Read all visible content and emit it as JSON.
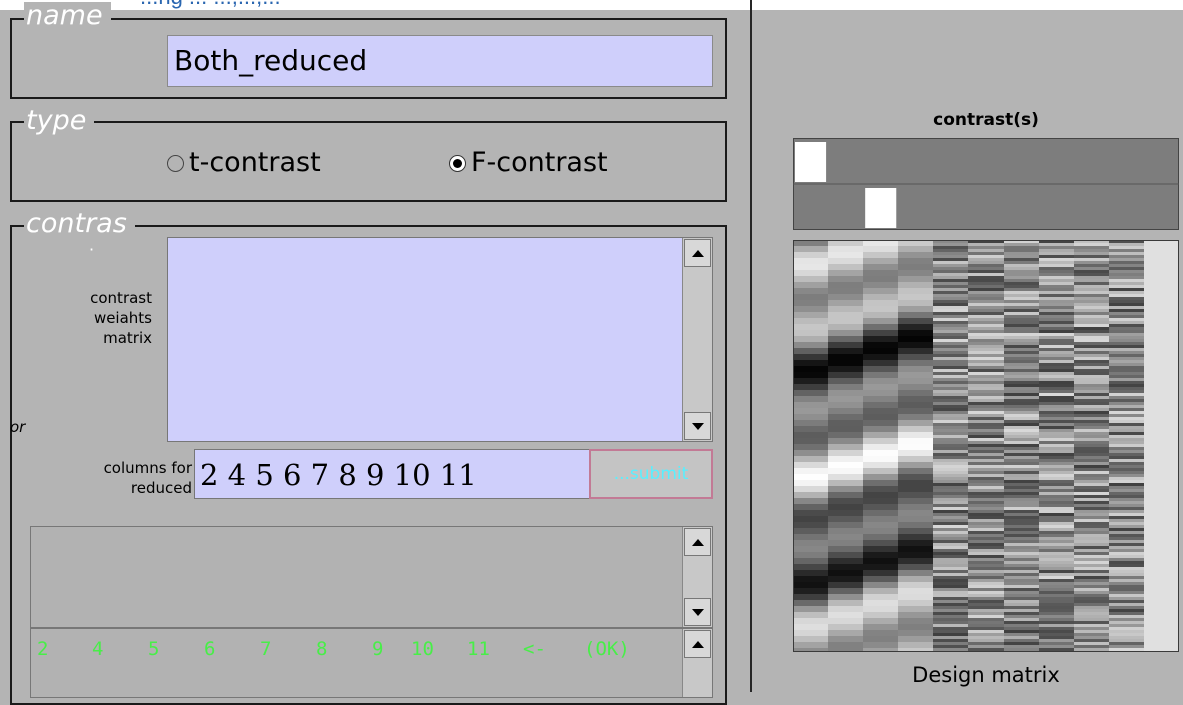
{
  "header_text": "...ng ... ...,...,...",
  "name_section": {
    "legend": "name",
    "value": "Both_reduced"
  },
  "type_section": {
    "legend": "type",
    "options": [
      {
        "label": "t-contrast",
        "checked": false
      },
      {
        "label": "F-contrast",
        "checked": true
      }
    ]
  },
  "contrast_section": {
    "legend": "contras",
    "legend_dot": "·",
    "weights_label": [
      "contrast",
      "weiahts",
      "matrix"
    ],
    "weights_value": "",
    "or_label": "or",
    "columns_label": [
      "columns for",
      "reduced"
    ],
    "columns_value": "2 4 5 6 7 8 9 10 11",
    "submit_label": "...submit"
  },
  "message_area": {
    "value": ""
  },
  "evaluated_list": [
    "2",
    "4",
    "5",
    "6",
    "7",
    "8",
    "9",
    "10",
    "11",
    "<-",
    "(OK)"
  ],
  "right_panel": {
    "contrast_title": "contrast(s)",
    "design_label": "Design matrix",
    "contrast_rows": [
      [
        1,
        0,
        0,
        0,
        0,
        0,
        0,
        0,
        0,
        0,
        0
      ],
      [
        0,
        0,
        1,
        0,
        0,
        0,
        0,
        0,
        0,
        0,
        0
      ]
    ]
  },
  "colors": {
    "background": "#b4b4b4",
    "input_fill": "#cfcffb",
    "legend_text": "#ffffff",
    "submit_text": "#58f0ff",
    "list_text": "#48ee48"
  }
}
